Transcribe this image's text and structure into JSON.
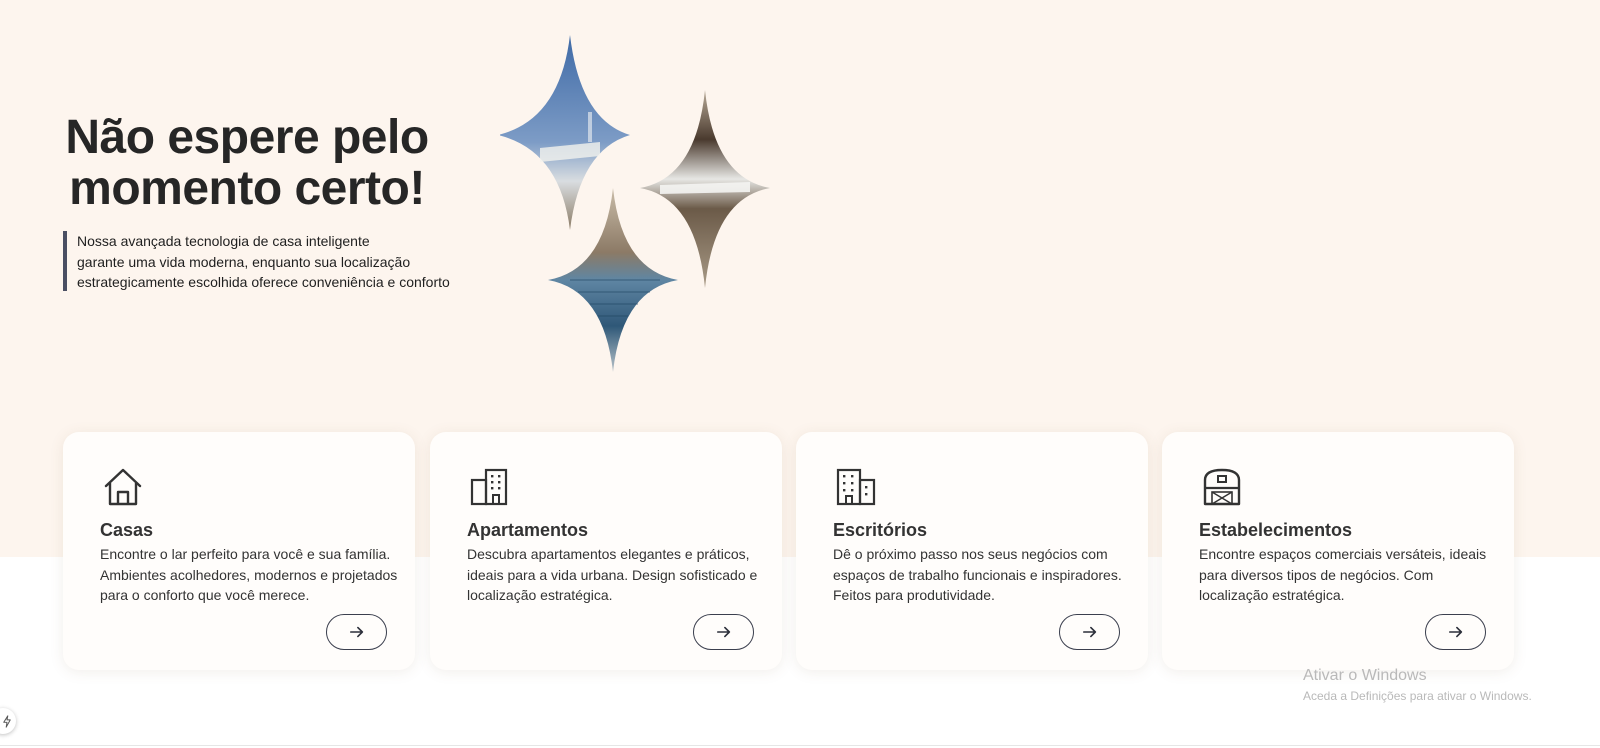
{
  "hero": {
    "title_line1": "Não espere pelo",
    "title_line2": "momento certo!",
    "description_line1": "Nossa avançada tecnologia de casa inteligente",
    "description_line2": "garante uma vida moderna, enquanto sua localização",
    "description_line3": "estrategicamente escolhida oferece conveniência e conforto"
  },
  "cards": [
    {
      "title": "Casas",
      "text": "Encontre o lar perfeito para você e sua família. Ambientes acolhedores, modernos e projetados para o conforto que você merece.",
      "icon": "house-icon"
    },
    {
      "title": "Apartamentos",
      "text": "Descubra apartamentos elegantes e práticos, ideais para a vida urbana. Design sofisticado e localização estratégica.",
      "icon": "apartment-building-icon"
    },
    {
      "title": "Escritórios",
      "text": "Dê o próximo passo nos seus negócios com espaços de trabalho funcionais e inspiradores. Feitos para produtividade.",
      "icon": "office-building-icon"
    },
    {
      "title": "Estabelecimentos",
      "text": "Encontre espaços comerciais versáteis, ideais para diversos tipos de negócios. Com localização estratégica.",
      "icon": "store-barn-icon"
    }
  ],
  "watermark": {
    "title": "Ativar o Windows",
    "subtitle": "Aceda a Definições para ativar o Windows."
  },
  "colors": {
    "hero_background": "#fdf5ee",
    "accent_bar": "#4a4f63",
    "text_dark": "#262626",
    "card_background": "#fffdfb"
  }
}
